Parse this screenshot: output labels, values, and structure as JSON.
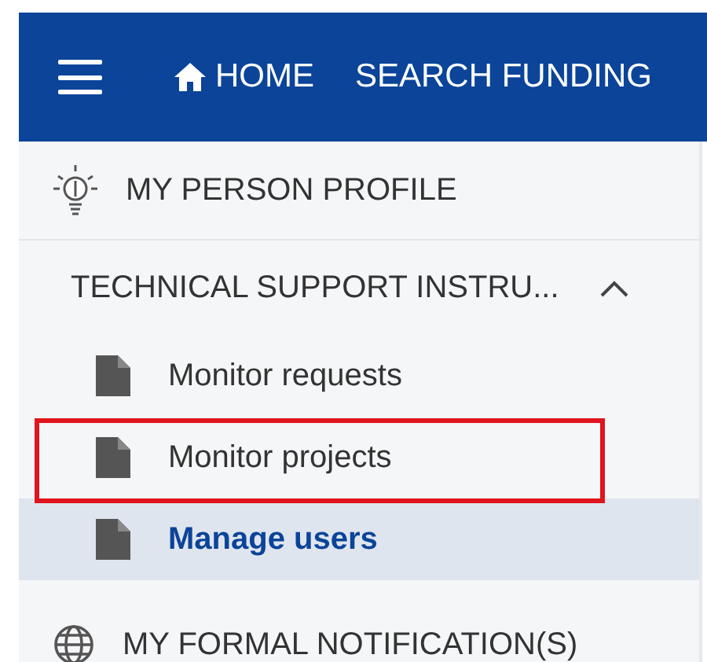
{
  "header": {
    "nav": [
      "HOME",
      "SEARCH FUNDING"
    ]
  },
  "menu": [
    {
      "kind": "section",
      "label": "MY PERSON PROFILE"
    },
    {
      "kind": "group",
      "label": "TECHNICAL SUPPORT INSTRU...",
      "expanded": true,
      "children": [
        {
          "label": "Monitor requests",
          "selected": false,
          "highlighted": false
        },
        {
          "label": "Monitor projects",
          "selected": false,
          "highlighted": true
        },
        {
          "label": "Manage users",
          "selected": true,
          "highlighted": false
        }
      ]
    },
    {
      "kind": "section",
      "label": "MY FORMAL NOTIFICATION(S)"
    }
  ]
}
